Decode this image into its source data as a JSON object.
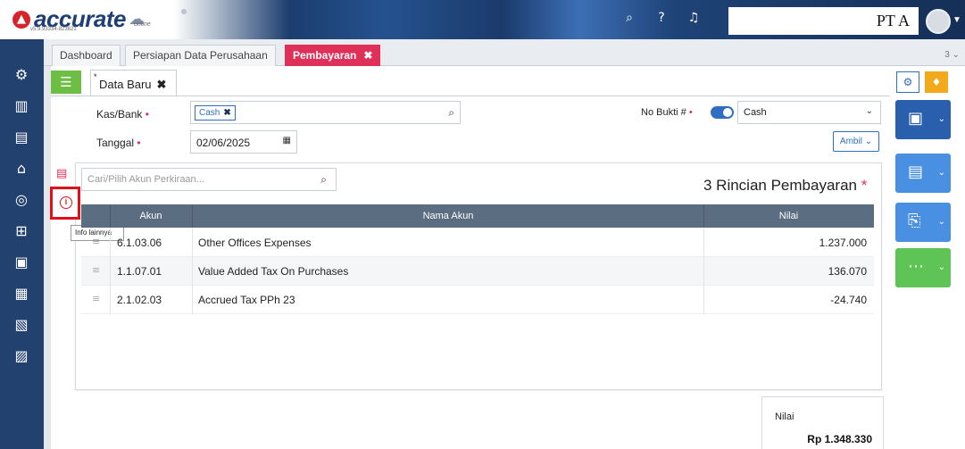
{
  "app": {
    "logo_text": "accurate",
    "online": "online",
    "version": "v5.9.93334-823621",
    "company": "PT A"
  },
  "tabs": [
    {
      "label": "Dashboard"
    },
    {
      "label": "Persiapan Data Perusahaan"
    },
    {
      "label": "Pembayaran",
      "close": "✖"
    }
  ],
  "tab_count": "3 ⌄",
  "doc_tab": {
    "label": "Data Baru",
    "close": "✖",
    "unsaved": "*"
  },
  "form": {
    "kas_bank_label": "Kas/Bank",
    "kas_bank_value": "Cash",
    "kas_bank_chip_close": "✖",
    "tanggal_label": "Tanggal",
    "tanggal_value": "02/06/2025",
    "no_bukti_label": "No Bukti #",
    "no_bukti_value": "Cash",
    "required_mark": "•",
    "ambil_label": "Ambil ⌄"
  },
  "detail": {
    "search_placeholder": "Cari/Pilih Akun Perkiraan...",
    "heading": "3 Rincian Pembayaran",
    "heading_mark": "*",
    "tooltip": "Info lainnya",
    "columns": [
      "Akun",
      "Nama Akun",
      "Nilai"
    ],
    "rows": [
      {
        "akun": "6.1.03.06",
        "nama": "Other Offices Expenses",
        "nilai": "1.237.000"
      },
      {
        "akun": "1.1.07.01",
        "nama": "Value Added Tax On Purchases",
        "nilai": "136.070"
      },
      {
        "akun": "2.1.02.03",
        "nama": "Accrued Tax PPh 23",
        "nilai": "-24.740"
      }
    ]
  },
  "total": {
    "label": "Nilai",
    "value": "Rp 1.348.330"
  },
  "colors": {
    "sidebar": "#23416e",
    "accent": "#e0305a",
    "primary": "#2a5fae",
    "success": "#5fc456",
    "warning": "#f3a91c"
  }
}
